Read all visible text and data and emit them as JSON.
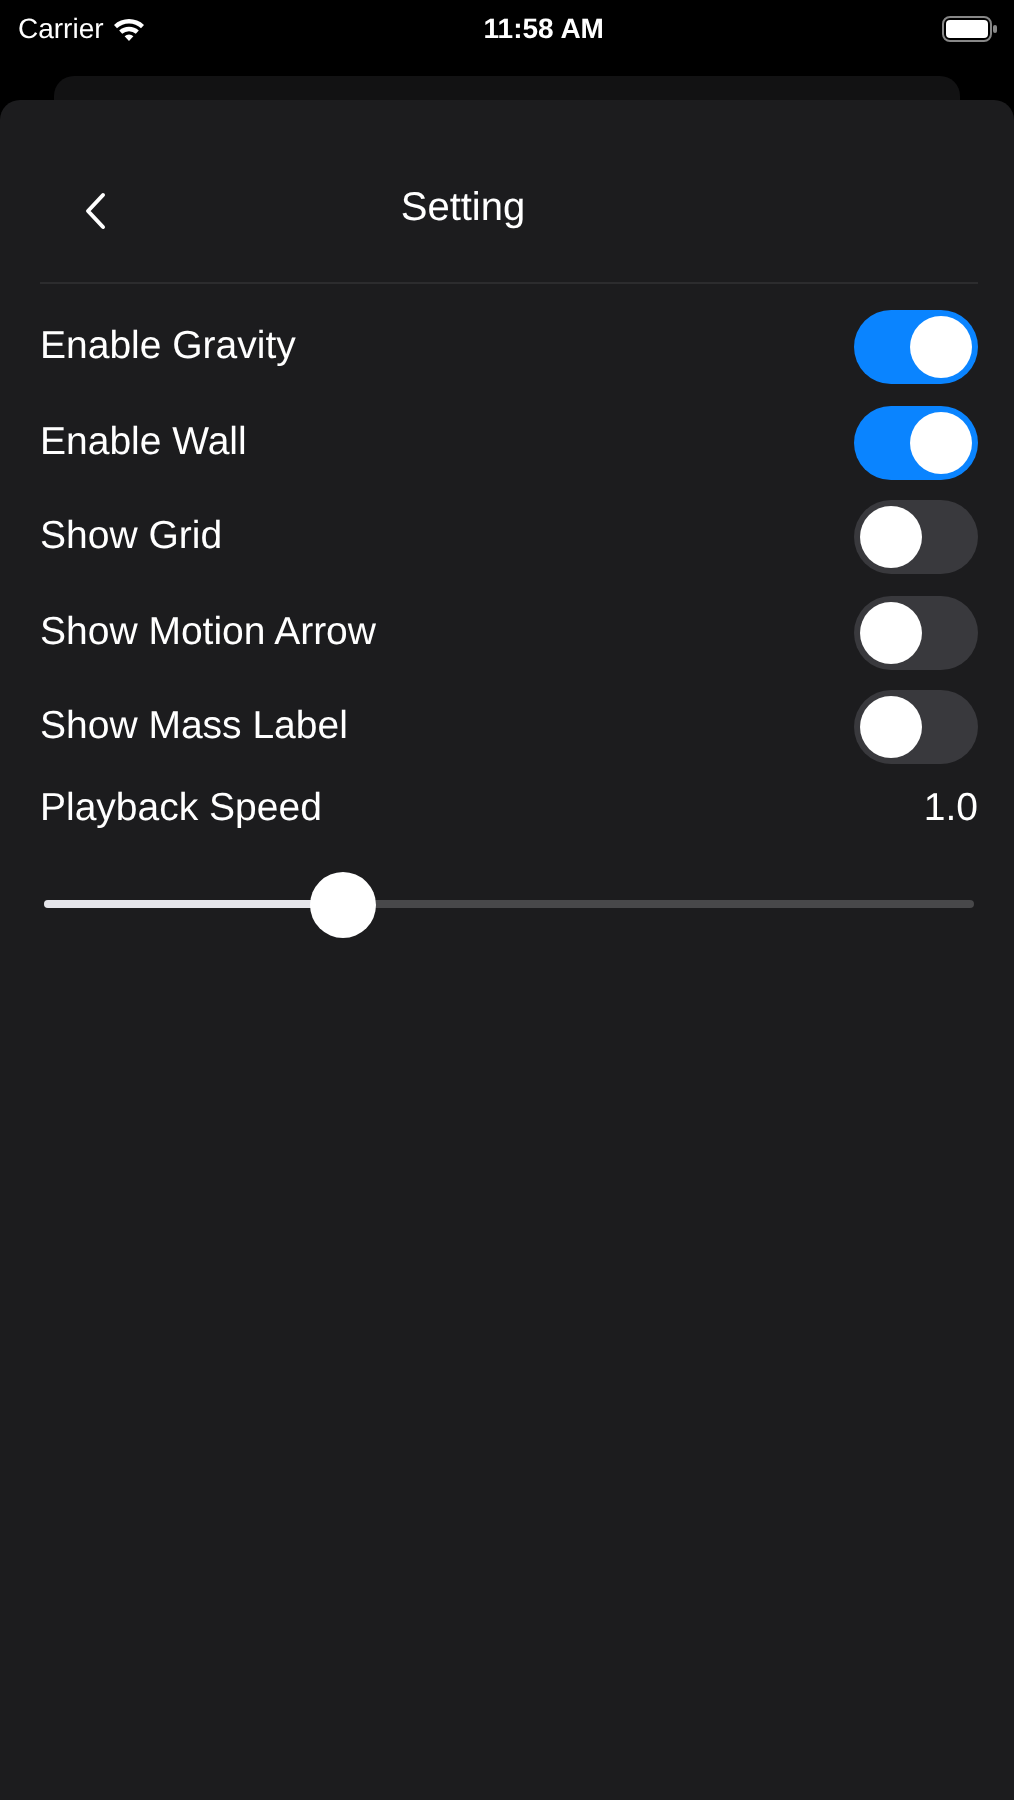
{
  "status_bar": {
    "carrier": "Carrier",
    "time": "11:58 AM"
  },
  "header": {
    "title": "Setting"
  },
  "settings": [
    {
      "kind": "toggle",
      "label": "Enable Gravity",
      "on": true
    },
    {
      "kind": "toggle",
      "label": "Enable Wall",
      "on": true
    },
    {
      "kind": "toggle",
      "label": "Show Grid",
      "on": false
    },
    {
      "kind": "toggle",
      "label": "Show Motion Arrow",
      "on": false
    },
    {
      "kind": "toggle",
      "label": "Show Mass Label",
      "on": false
    },
    {
      "kind": "slider",
      "label": "Playback Speed",
      "reading": "1.0",
      "level": 0.32
    }
  ]
}
